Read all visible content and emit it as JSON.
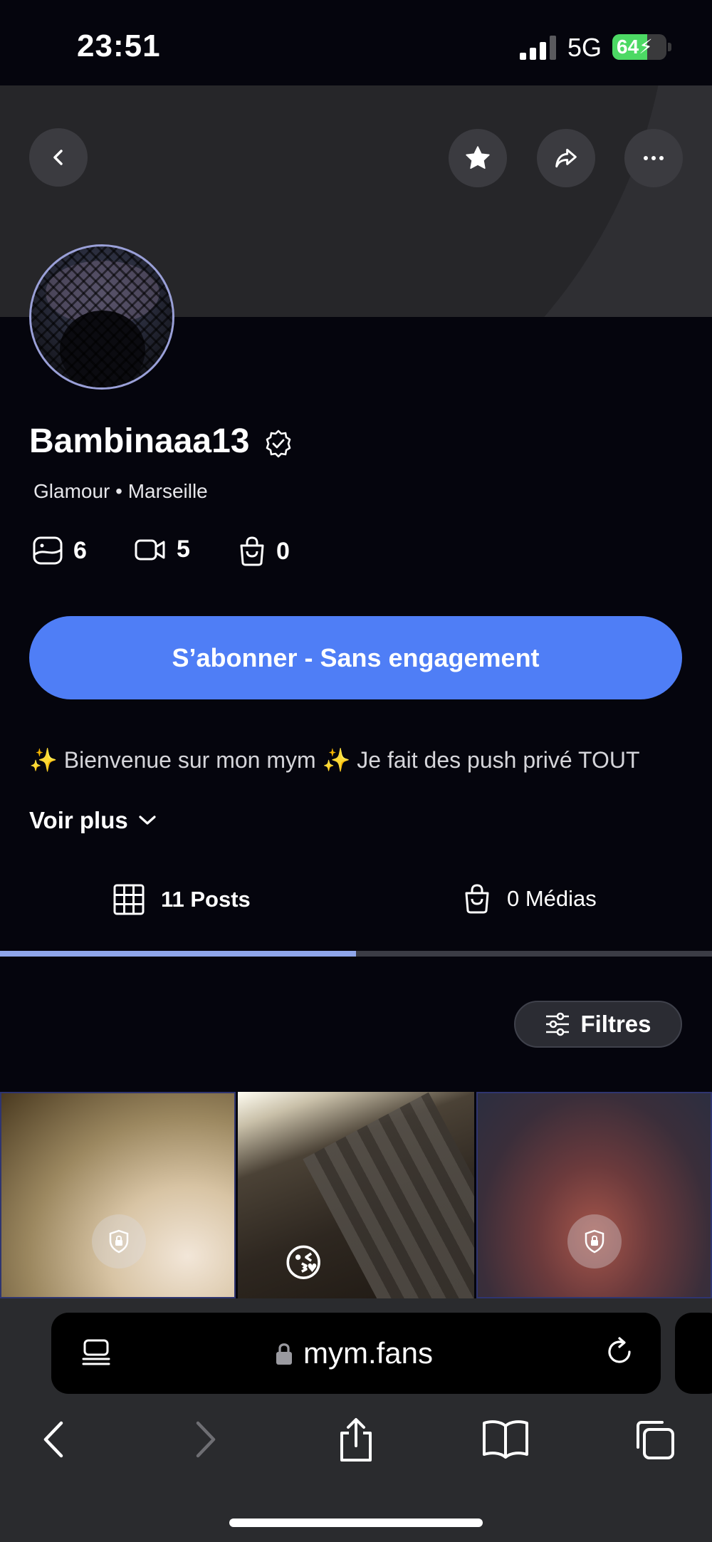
{
  "status_bar": {
    "time": "23:51",
    "network": "5G",
    "battery": "64",
    "battery_level": 0.64
  },
  "profile": {
    "username": "Bambinaaa13",
    "tagline": "Glamour • Marseille",
    "stats": {
      "photos": "6",
      "videos": "5",
      "items": "0"
    },
    "subscribe_label": "S’abonner - Sans engagement",
    "bio": "✨ Bienvenue sur mon mym ✨ Je fait des push privé TOUT",
    "see_more_label": "Voir plus"
  },
  "tabs": [
    {
      "label": "11 Posts",
      "active": true
    },
    {
      "label": "0 Médias",
      "active": false
    }
  ],
  "filters_label": "Filtres",
  "grid": {
    "emoji": "😘"
  },
  "browser": {
    "url": "mym.fans"
  },
  "colors": {
    "accent": "#4f7ef6",
    "background": "#05050d",
    "tab_indicator": "#8fa6ea"
  },
  "icons": [
    "back-icon",
    "star-icon",
    "share-icon",
    "more-icon",
    "verified-icon",
    "photo-icon",
    "video-icon",
    "bag-icon",
    "chevron-down-icon",
    "grid-icon",
    "filter-icon",
    "lock-icon",
    "reader-icon",
    "reload-icon",
    "forward-icon",
    "bookmarks-icon",
    "tabs-icon"
  ]
}
